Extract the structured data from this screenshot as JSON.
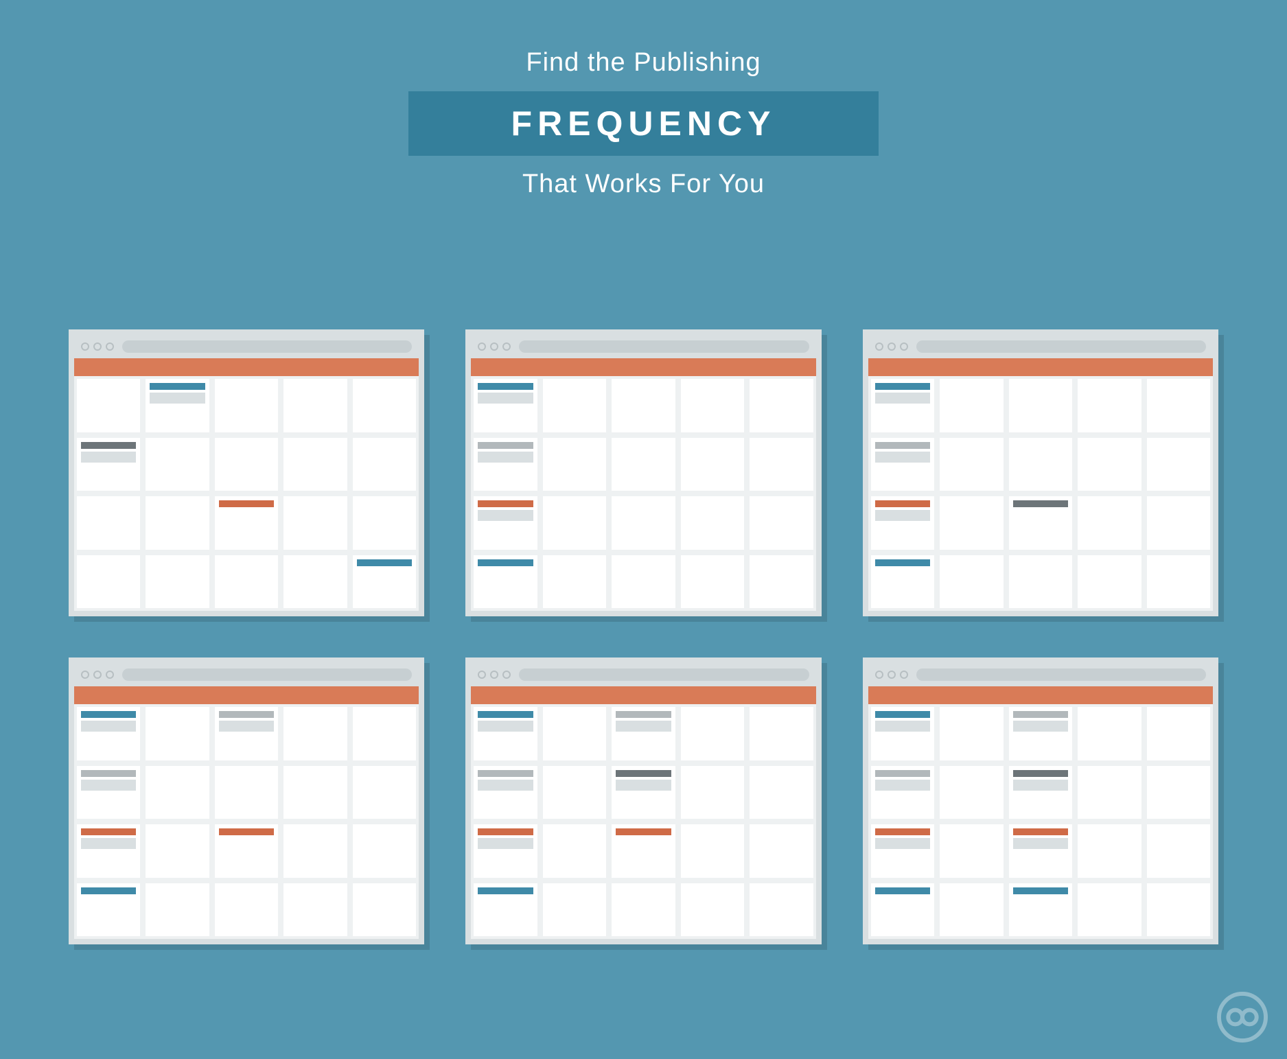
{
  "heading": {
    "line1": "Find the Publishing",
    "line2": "FREQUENCY",
    "line3": "That Works For You"
  },
  "colors": {
    "blue": "#3f8aa8",
    "grey": "#b2b8bb",
    "dark": "#6d7579",
    "orange": "#cf6b47"
  },
  "windows": [
    {
      "entries": [
        {
          "row": 0,
          "col": 1,
          "color": "blue",
          "body": true
        },
        {
          "row": 1,
          "col": 0,
          "color": "dark",
          "body": true
        },
        {
          "row": 2,
          "col": 2,
          "color": "orange",
          "body": false
        },
        {
          "row": 3,
          "col": 4,
          "color": "blue",
          "body": false
        }
      ]
    },
    {
      "entries": [
        {
          "row": 0,
          "col": 0,
          "color": "blue",
          "body": true
        },
        {
          "row": 1,
          "col": 0,
          "color": "grey",
          "body": true
        },
        {
          "row": 2,
          "col": 0,
          "color": "orange",
          "body": true
        },
        {
          "row": 3,
          "col": 0,
          "color": "blue",
          "body": false
        }
      ]
    },
    {
      "entries": [
        {
          "row": 0,
          "col": 0,
          "color": "blue",
          "body": true
        },
        {
          "row": 1,
          "col": 0,
          "color": "grey",
          "body": true
        },
        {
          "row": 2,
          "col": 0,
          "color": "orange",
          "body": true
        },
        {
          "row": 2,
          "col": 2,
          "color": "dark",
          "body": false
        },
        {
          "row": 3,
          "col": 0,
          "color": "blue",
          "body": false
        }
      ]
    },
    {
      "entries": [
        {
          "row": 0,
          "col": 0,
          "color": "blue",
          "body": true
        },
        {
          "row": 0,
          "col": 2,
          "color": "grey",
          "body": true
        },
        {
          "row": 1,
          "col": 0,
          "color": "grey",
          "body": true
        },
        {
          "row": 2,
          "col": 0,
          "color": "orange",
          "body": true
        },
        {
          "row": 2,
          "col": 2,
          "color": "orange",
          "body": false
        },
        {
          "row": 3,
          "col": 0,
          "color": "blue",
          "body": false
        }
      ]
    },
    {
      "entries": [
        {
          "row": 0,
          "col": 0,
          "color": "blue",
          "body": true
        },
        {
          "row": 0,
          "col": 2,
          "color": "grey",
          "body": true
        },
        {
          "row": 1,
          "col": 0,
          "color": "grey",
          "body": true
        },
        {
          "row": 1,
          "col": 2,
          "color": "dark",
          "body": true
        },
        {
          "row": 2,
          "col": 0,
          "color": "orange",
          "body": true
        },
        {
          "row": 2,
          "col": 2,
          "color": "orange",
          "body": false
        },
        {
          "row": 3,
          "col": 0,
          "color": "blue",
          "body": false
        }
      ]
    },
    {
      "entries": [
        {
          "row": 0,
          "col": 0,
          "color": "blue",
          "body": true
        },
        {
          "row": 0,
          "col": 2,
          "color": "grey",
          "body": true
        },
        {
          "row": 1,
          "col": 0,
          "color": "grey",
          "body": true
        },
        {
          "row": 1,
          "col": 2,
          "color": "dark",
          "body": true
        },
        {
          "row": 2,
          "col": 0,
          "color": "orange",
          "body": true
        },
        {
          "row": 2,
          "col": 2,
          "color": "orange",
          "body": true
        },
        {
          "row": 3,
          "col": 0,
          "color": "blue",
          "body": false
        },
        {
          "row": 3,
          "col": 2,
          "color": "blue",
          "body": false
        }
      ]
    }
  ],
  "logo_label": "CoSchedule"
}
